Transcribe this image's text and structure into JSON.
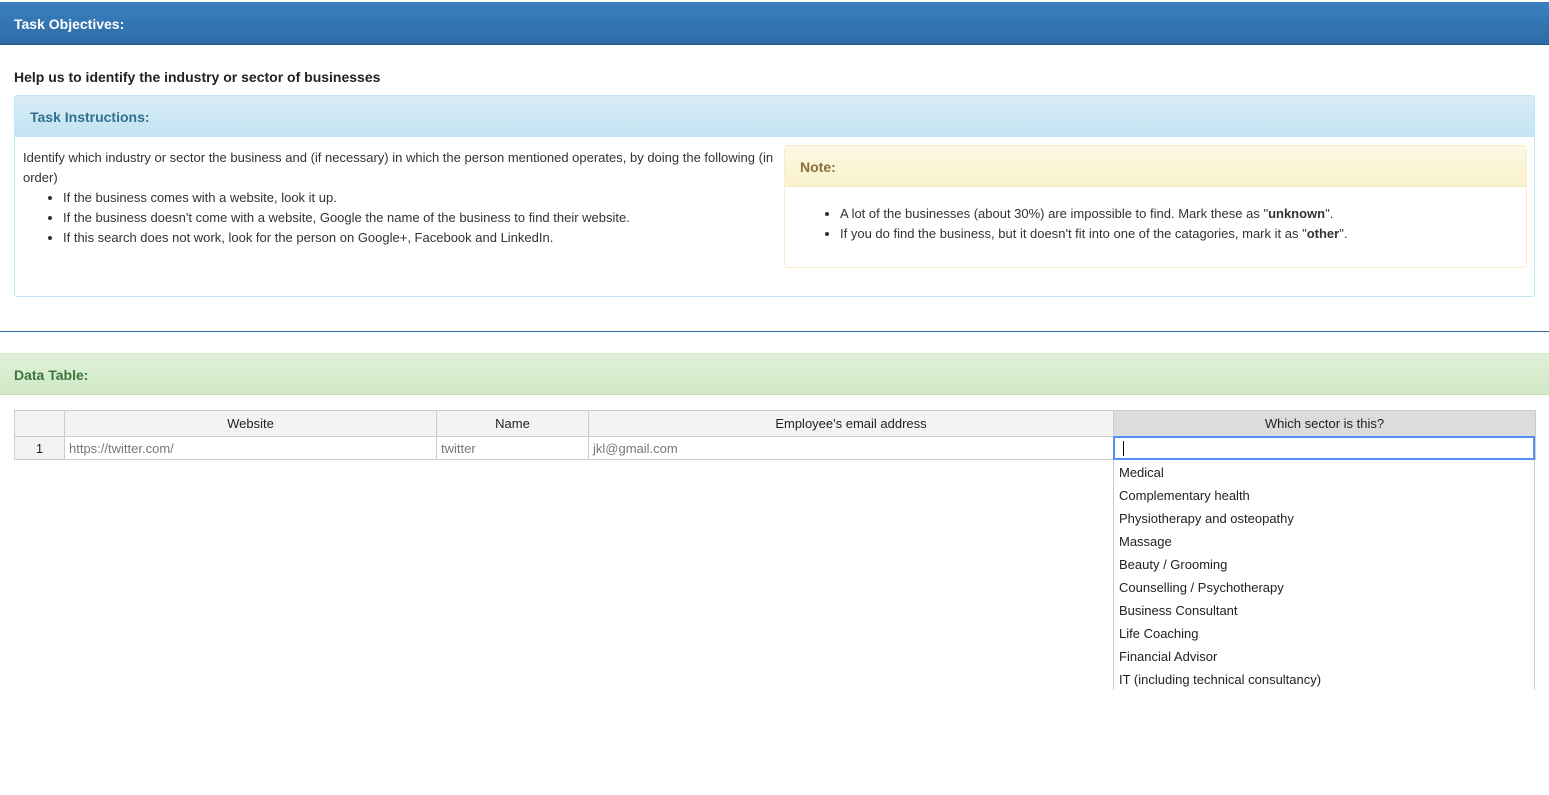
{
  "header": {
    "title": "Task Objectives:"
  },
  "objective": "Help us to identify the industry or sector of businesses",
  "instructions": {
    "title": "Task Instructions:",
    "intro": "Identify which industry or sector the business and (if necessary) in which the person mentioned operates, by doing the following (in order)",
    "steps": [
      "If the business comes with a website, look it up.",
      "If the business doesn't come with a website, Google the name of the business to find their website.",
      "If this search does not work, look for the person on Google+, Facebook and LinkedIn."
    ]
  },
  "note": {
    "title": "Note:",
    "item1_pre": "A lot of the businesses (about 30%) are impossible to find. Mark these as \"",
    "item1_bold": "unknown",
    "item1_post": "\".",
    "item2_pre": "If you do find the business, but it doesn't fit into one of the catagories, mark it as \"",
    "item2_bold": "other",
    "item2_post": "\"."
  },
  "data_table": {
    "title": "Data Table:",
    "columns": [
      "Website",
      "Name",
      "Employee's email address",
      "Which sector is this?"
    ],
    "rows": [
      {
        "num": "1",
        "website": "https://twitter.com/",
        "name": "twitter",
        "email": "jkl@gmail.com",
        "sector": ""
      }
    ]
  },
  "sector_options": [
    "Medical",
    "Complementary health",
    "Physiotherapy and osteopathy",
    "Massage",
    "Beauty / Grooming",
    "Counselling / Psychotherapy",
    "Business Consultant",
    "Life Coaching",
    "Financial Advisor",
    "IT (including technical consultancy)"
  ]
}
